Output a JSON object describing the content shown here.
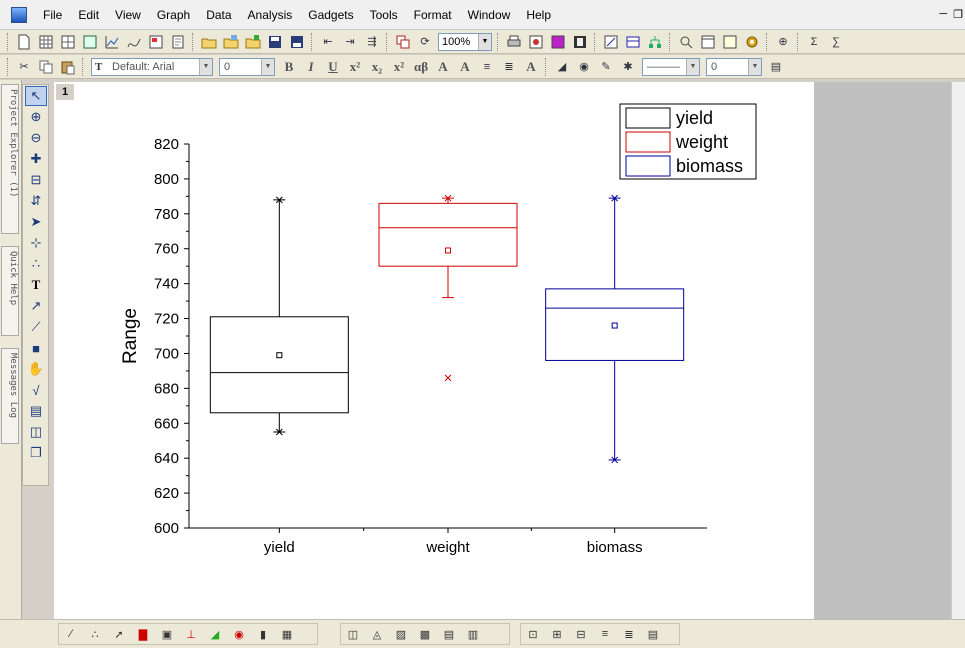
{
  "menubar": {
    "items": [
      "File",
      "Edit",
      "View",
      "Graph",
      "Data",
      "Analysis",
      "Gadgets",
      "Tools",
      "Format",
      "Window",
      "Help"
    ]
  },
  "toolbar": {
    "zoom_value": "100%",
    "font_name": "Default: Arial",
    "font_size": "0",
    "line_width": "0"
  },
  "side_tabs": [
    "Project Explorer (1)",
    "Quick Help",
    "Messages Log"
  ],
  "graph_window": {
    "layer_label": "1"
  },
  "chart_data": {
    "type": "box",
    "ylabel": "Range",
    "xlabel": "",
    "ylim": [
      600,
      820
    ],
    "yticks": [
      600,
      620,
      640,
      660,
      680,
      700,
      720,
      740,
      760,
      780,
      800,
      820
    ],
    "categories": [
      "yield",
      "weight",
      "biomass"
    ],
    "series": [
      {
        "name": "yield",
        "color": "#000000",
        "whisker_low": 655,
        "q1": 666,
        "median": 689,
        "q3": 721,
        "whisker_high": 788,
        "mean": 699,
        "min_marker": 655,
        "max_marker": 788,
        "outliers": []
      },
      {
        "name": "weight",
        "color": "#d00000",
        "whisker_low": 732,
        "q1": 750,
        "median": 772,
        "q3": 786,
        "whisker_high": 789,
        "mean": 759,
        "min_marker": 686,
        "max_marker": 789,
        "outliers": [
          686
        ]
      },
      {
        "name": "biomass",
        "color": "#00009a",
        "whisker_low": 639,
        "q1": 696,
        "median": 726,
        "q3": 737,
        "whisker_high": 789,
        "mean": 716,
        "min_marker": 639,
        "max_marker": 789,
        "outliers": []
      }
    ],
    "legend": [
      "yield",
      "weight",
      "biomass"
    ],
    "legend_placement": "top-right",
    "grid": false
  }
}
